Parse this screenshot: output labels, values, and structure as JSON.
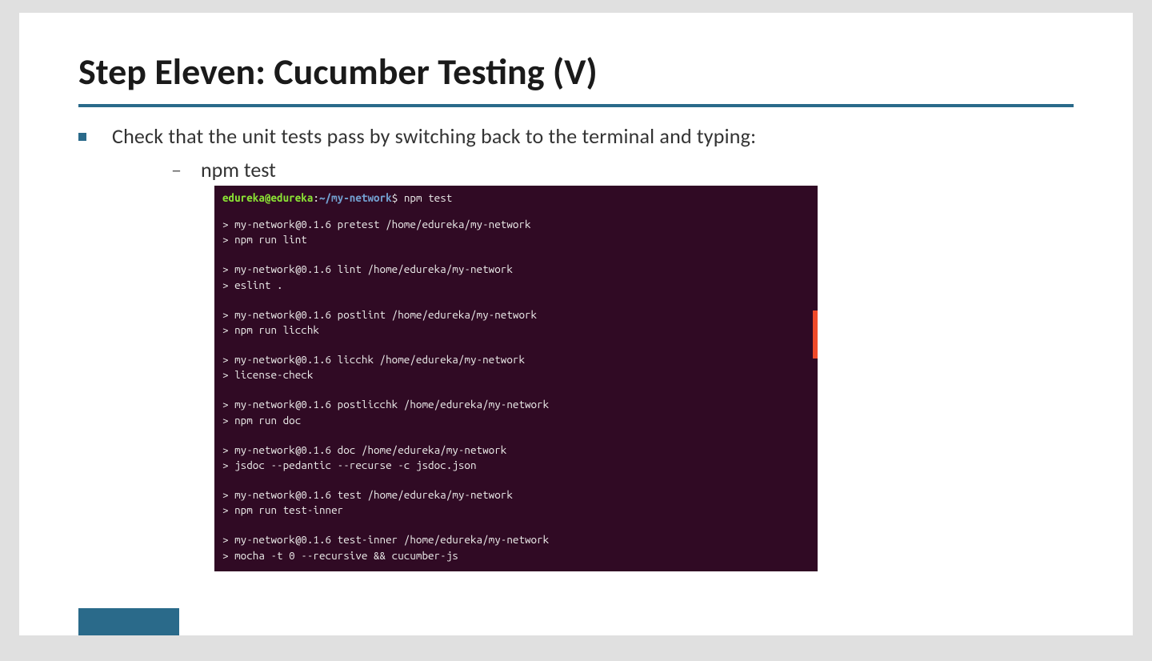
{
  "title": "Step Eleven: Cucumber Testing (V)",
  "bullet": "Check that the unit tests pass by switching back to the terminal and  typing:",
  "sub_dash": "–",
  "sub_text": "npm test",
  "terminal": {
    "prompt_user": "edureka@edureka",
    "prompt_colon": ":",
    "prompt_path": "~/my-network",
    "prompt_dollar": "$ ",
    "prompt_cmd": "npm test",
    "blocks": [
      [
        "> my-network@0.1.6 pretest /home/edureka/my-network",
        "> npm run lint"
      ],
      [
        "> my-network@0.1.6 lint /home/edureka/my-network",
        "> eslint ."
      ],
      [
        "> my-network@0.1.6 postlint /home/edureka/my-network",
        "> npm run licchk"
      ],
      [
        "> my-network@0.1.6 licchk /home/edureka/my-network",
        "> license-check"
      ],
      [
        "> my-network@0.1.6 postlicchk /home/edureka/my-network",
        "> npm run doc"
      ],
      [
        "> my-network@0.1.6 doc /home/edureka/my-network",
        "> jsdoc --pedantic --recurse -c jsdoc.json"
      ],
      [
        "> my-network@0.1.6 test /home/edureka/my-network",
        "> npm run test-inner"
      ],
      [
        "> my-network@0.1.6 test-inner /home/edureka/my-network",
        "> mocha -t 0 --recursive && cucumber-js"
      ]
    ]
  }
}
